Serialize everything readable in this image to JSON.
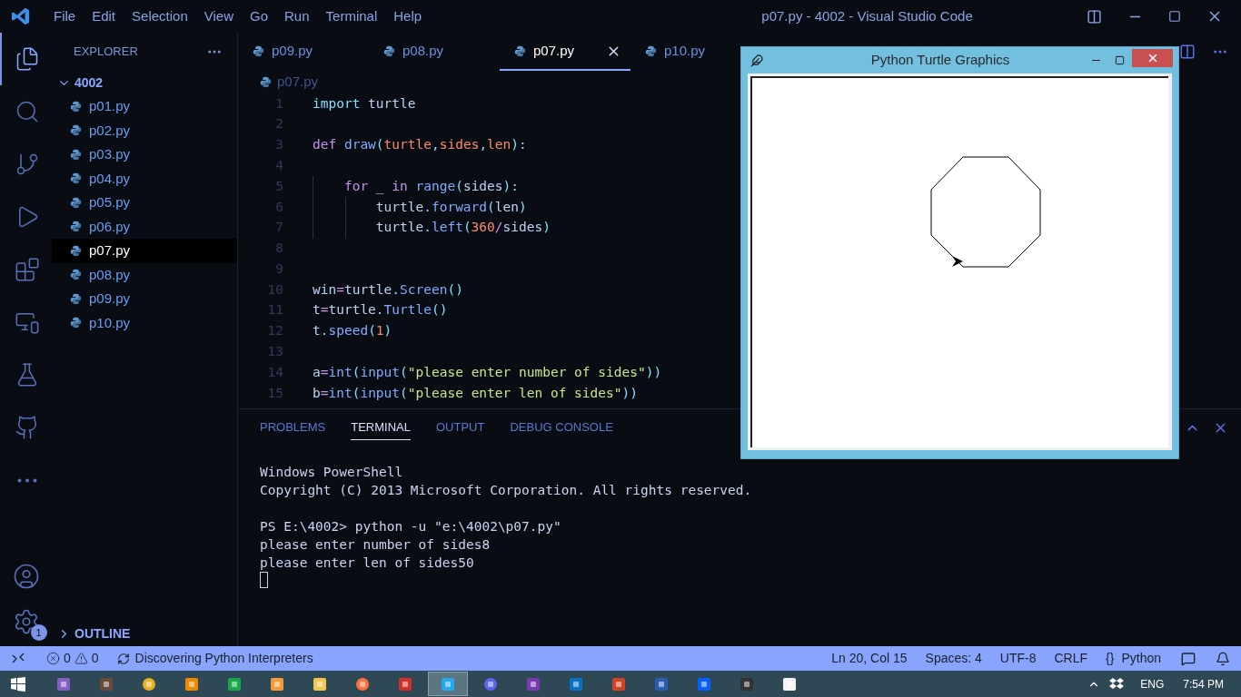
{
  "window": {
    "title": "p07.py - 4002 - Visual Studio Code"
  },
  "menu": [
    "File",
    "Edit",
    "Selection",
    "View",
    "Go",
    "Run",
    "Terminal",
    "Help"
  ],
  "activity_bar": [
    {
      "kind": "files",
      "selected": true
    },
    {
      "kind": "search",
      "selected": false
    },
    {
      "kind": "git",
      "selected": false
    },
    {
      "kind": "debug",
      "selected": false
    },
    {
      "kind": "extensions",
      "selected": false
    },
    {
      "kind": "remote",
      "selected": false
    },
    {
      "kind": "flask",
      "selected": false
    },
    {
      "kind": "github",
      "selected": false
    },
    {
      "kind": "more",
      "selected": false
    }
  ],
  "activity_bottom": {
    "settings_badge": "1"
  },
  "sidebar": {
    "title": "EXPLORER",
    "folder": {
      "name": "4002",
      "expanded": true,
      "children": [
        {
          "name": "p01.py",
          "selected": false
        },
        {
          "name": "p02.py",
          "selected": false
        },
        {
          "name": "p03.py",
          "selected": false
        },
        {
          "name": "p04.py",
          "selected": false
        },
        {
          "name": "p05.py",
          "selected": false
        },
        {
          "name": "p06.py",
          "selected": false
        },
        {
          "name": "p07.py",
          "selected": true
        },
        {
          "name": "p08.py",
          "selected": false
        },
        {
          "name": "p09.py",
          "selected": false
        },
        {
          "name": "p10.py",
          "selected": false
        }
      ]
    },
    "outline": {
      "label": "OUTLINE",
      "expanded": false
    }
  },
  "tabs": [
    {
      "label": "p09.py",
      "selected": false
    },
    {
      "label": "p08.py",
      "selected": false
    },
    {
      "label": "p07.py",
      "selected": true
    },
    {
      "label": "p10.py",
      "selected": false
    }
  ],
  "breadcrumb": "p07.py",
  "code": [
    {
      "number": "1",
      "tokens": [
        {
          "kind": "import",
          "text": "import"
        },
        {
          "kind": "var",
          "text": " turtle"
        }
      ]
    },
    {
      "number": "2"
    },
    {
      "number": "3",
      "tokens": [
        {
          "kind": "keyword",
          "text": "def"
        },
        {
          "kind": "func",
          "text": " draw"
        },
        {
          "kind": "punc",
          "text": "("
        },
        {
          "kind": "param",
          "text": "turtle"
        },
        {
          "kind": "punc",
          "text": ","
        },
        {
          "kind": "param",
          "text": "sides"
        },
        {
          "kind": "punc",
          "text": ","
        },
        {
          "kind": "param",
          "text": "len"
        },
        {
          "kind": "punc",
          "text": "):"
        }
      ]
    },
    {
      "number": "4"
    },
    {
      "number": "5",
      "tokens": [
        {
          "kind": "keyword",
          "text": "    for"
        },
        {
          "kind": "var",
          "text": " _ "
        },
        {
          "kind": "keyword",
          "text": "in"
        },
        {
          "kind": "func",
          "text": " range"
        },
        {
          "kind": "punc",
          "text": "("
        },
        {
          "kind": "var",
          "text": "sides"
        },
        {
          "kind": "punc",
          "text": "):"
        }
      ]
    },
    {
      "number": "6",
      "tokens": [
        {
          "kind": "var",
          "text": "        turtle"
        },
        {
          "kind": "punc",
          "text": "."
        },
        {
          "kind": "func",
          "text": "forward"
        },
        {
          "kind": "punc",
          "text": "("
        },
        {
          "kind": "var",
          "text": "len"
        },
        {
          "kind": "punc",
          "text": ")"
        }
      ]
    },
    {
      "number": "7",
      "tokens": [
        {
          "kind": "var",
          "text": "        turtle"
        },
        {
          "kind": "punc",
          "text": "."
        },
        {
          "kind": "func",
          "text": "left"
        },
        {
          "kind": "punc",
          "text": "("
        },
        {
          "kind": "number",
          "text": "360"
        },
        {
          "kind": "op",
          "text": "/"
        },
        {
          "kind": "var",
          "text": "sides"
        },
        {
          "kind": "punc",
          "text": ")"
        }
      ]
    },
    {
      "number": "8"
    },
    {
      "number": "9"
    },
    {
      "number": "10",
      "tokens": [
        {
          "kind": "var",
          "text": "win"
        },
        {
          "kind": "op",
          "text": "="
        },
        {
          "kind": "var",
          "text": "turtle"
        },
        {
          "kind": "punc",
          "text": "."
        },
        {
          "kind": "func",
          "text": "Screen"
        },
        {
          "kind": "punc",
          "text": "()"
        }
      ]
    },
    {
      "number": "11",
      "tokens": [
        {
          "kind": "var",
          "text": "t"
        },
        {
          "kind": "op",
          "text": "="
        },
        {
          "kind": "var",
          "text": "turtle"
        },
        {
          "kind": "punc",
          "text": "."
        },
        {
          "kind": "func",
          "text": "Turtle"
        },
        {
          "kind": "punc",
          "text": "()"
        }
      ]
    },
    {
      "number": "12",
      "tokens": [
        {
          "kind": "var",
          "text": "t"
        },
        {
          "kind": "punc",
          "text": "."
        },
        {
          "kind": "func",
          "text": "speed"
        },
        {
          "kind": "punc",
          "text": "("
        },
        {
          "kind": "number",
          "text": "1"
        },
        {
          "kind": "punc",
          "text": ")"
        }
      ]
    },
    {
      "number": "13"
    },
    {
      "number": "14",
      "tokens": [
        {
          "kind": "var",
          "text": "a"
        },
        {
          "kind": "op",
          "text": "="
        },
        {
          "kind": "func",
          "text": "int"
        },
        {
          "kind": "punc",
          "text": "("
        },
        {
          "kind": "func",
          "text": "input"
        },
        {
          "kind": "punc",
          "text": "("
        },
        {
          "kind": "string",
          "text": "\"please enter number of sides\""
        },
        {
          "kind": "punc",
          "text": "))"
        }
      ]
    },
    {
      "number": "15",
      "tokens": [
        {
          "kind": "var",
          "text": "b"
        },
        {
          "kind": "op",
          "text": "="
        },
        {
          "kind": "func",
          "text": "int"
        },
        {
          "kind": "punc",
          "text": "("
        },
        {
          "kind": "func",
          "text": "input"
        },
        {
          "kind": "punc",
          "text": "("
        },
        {
          "kind": "string",
          "text": "\"please enter len of sides\""
        },
        {
          "kind": "punc",
          "text": "))"
        }
      ]
    }
  ],
  "panel": {
    "tabs": [
      {
        "label": "PROBLEMS",
        "selected": false
      },
      {
        "label": "TERMINAL",
        "selected": true
      },
      {
        "label": "OUTPUT",
        "selected": false
      },
      {
        "label": "DEBUG CONSOLE",
        "selected": false
      }
    ],
    "terminal_blocks": [
      [
        "Windows PowerShell",
        "Copyright (C) 2013 Microsoft Corporation. All rights reserved."
      ],
      [
        "PS E:\\4002> python -u \"e:\\4002\\p07.py\"",
        "please enter number of sides8",
        "please enter len of sides50"
      ]
    ]
  },
  "turtle_window": {
    "title": "Python Turtle Graphics"
  },
  "status_bar": {
    "errors": "0",
    "warnings": "0",
    "message": "Discovering Python Interpreters",
    "position": "Ln 20, Col 15",
    "spaces": "Spaces: 4",
    "encoding": "UTF-8",
    "eol": "CRLF",
    "language_brace": "{}",
    "language": "Python"
  },
  "taskbar": {
    "apps": [
      {
        "kind": "vs",
        "selected": false
      },
      {
        "kind": "game",
        "selected": false
      },
      {
        "kind": "chrome",
        "selected": false
      },
      {
        "kind": "vlc",
        "selected": false
      },
      {
        "kind": "store",
        "selected": false
      },
      {
        "kind": "sublime",
        "selected": false
      },
      {
        "kind": "explorer",
        "selected": false
      },
      {
        "kind": "firefox",
        "selected": false
      },
      {
        "kind": "blocks",
        "selected": false
      },
      {
        "kind": "vscode",
        "selected": true
      },
      {
        "kind": "discord",
        "selected": false
      },
      {
        "kind": "onenote",
        "selected": false
      },
      {
        "kind": "outlook",
        "selected": false
      },
      {
        "kind": "powerpoint",
        "selected": false
      },
      {
        "kind": "word",
        "selected": false
      },
      {
        "kind": "dropbox",
        "selected": false
      },
      {
        "kind": "terminal",
        "selected": false
      },
      {
        "kind": "notepad",
        "selected": false
      }
    ],
    "language": "ENG",
    "time": "7:54 PM"
  }
}
